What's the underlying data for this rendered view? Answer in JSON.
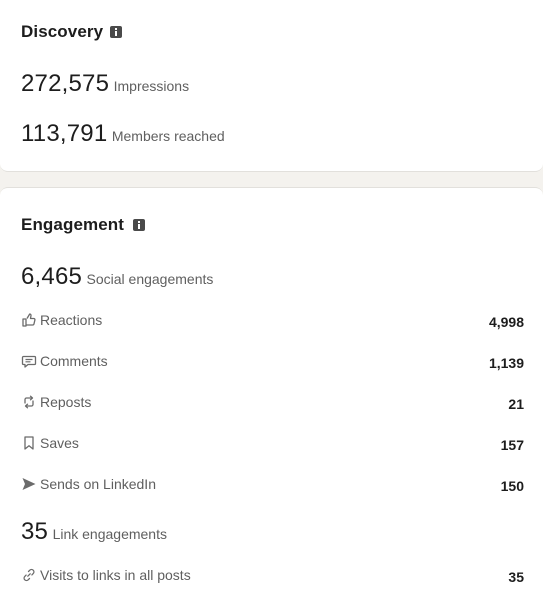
{
  "discovery": {
    "title": "Discovery",
    "impressions": {
      "value": "272,575",
      "label": "Impressions"
    },
    "members_reached": {
      "value": "113,791",
      "label": "Members reached"
    }
  },
  "engagement": {
    "title": "Engagement",
    "social": {
      "value": "6,465",
      "label": "Social engagements"
    },
    "rows": [
      {
        "label": "Reactions",
        "value": "4,998",
        "icon": "thumbs-up-icon"
      },
      {
        "label": "Comments",
        "value": "1,139",
        "icon": "comment-icon"
      },
      {
        "label": "Reposts",
        "value": "21",
        "icon": "repost-icon"
      },
      {
        "label": "Saves",
        "value": "157",
        "icon": "bookmark-icon"
      },
      {
        "label": "Sends on LinkedIn",
        "value": "150",
        "icon": "send-icon"
      }
    ],
    "link": {
      "value": "35",
      "label": "Link engagements"
    },
    "link_rows": [
      {
        "label": "Visits to links in all posts",
        "value": "35",
        "icon": "link-icon"
      }
    ]
  }
}
